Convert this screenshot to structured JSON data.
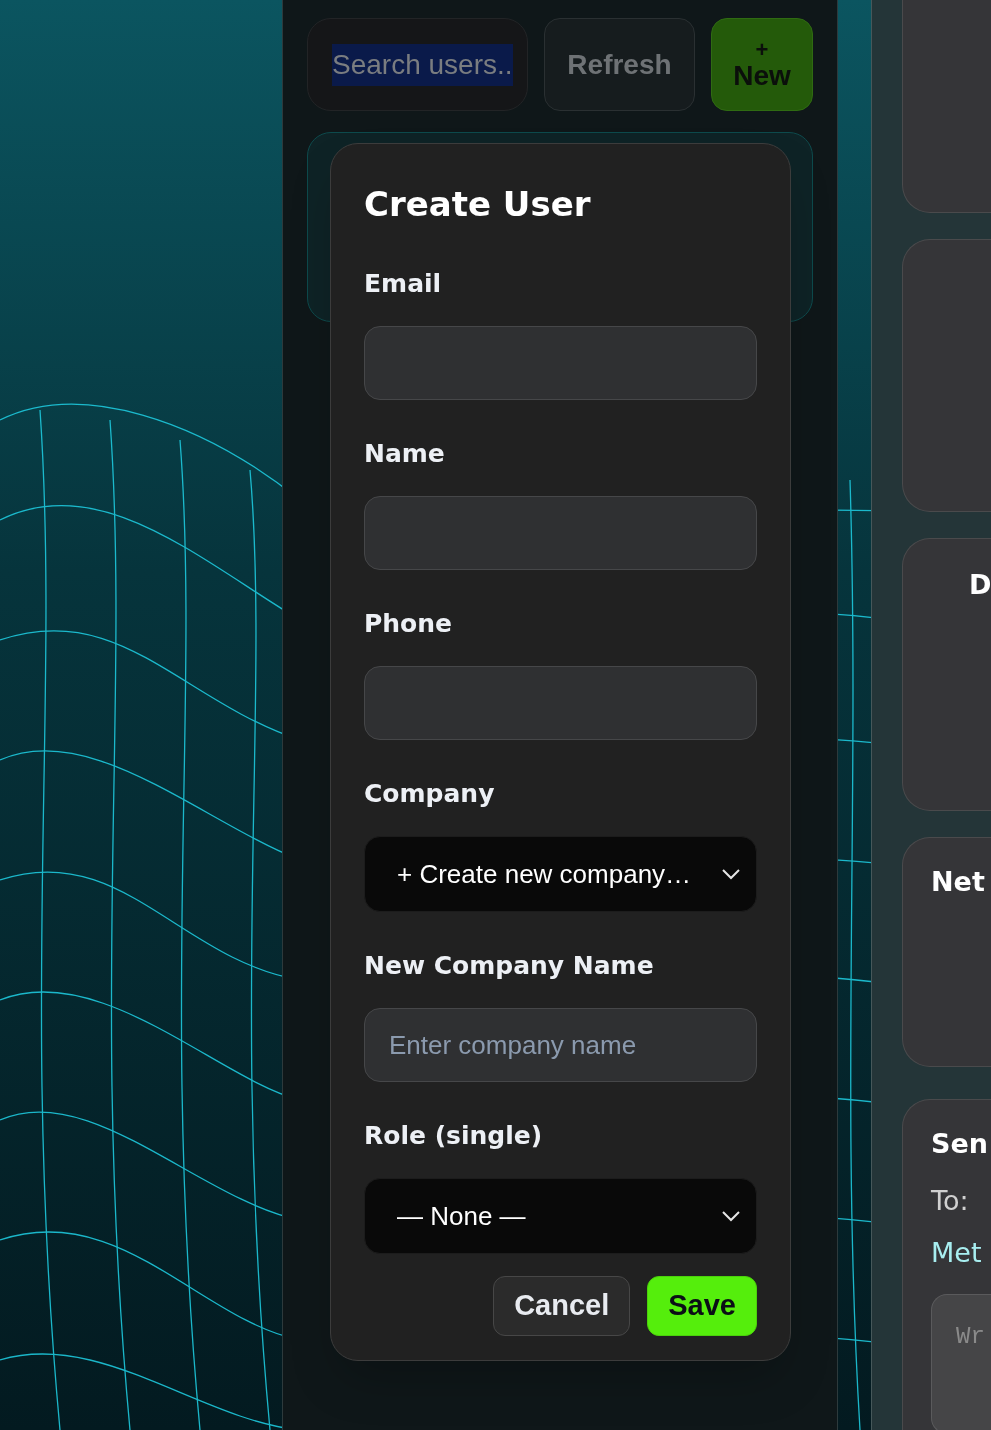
{
  "toolbar": {
    "search": {
      "value": "Search users..",
      "highlighted": true
    },
    "buttons": [
      {
        "label": "Refresh",
        "kind": "secondary"
      },
      {
        "label": "New",
        "icon": "+",
        "kind": "primary"
      }
    ]
  },
  "dialog": {
    "title": "Create User",
    "fields": [
      {
        "label": "Email",
        "kind": "input"
      },
      {
        "label": "Name",
        "kind": "input"
      },
      {
        "label": "Phone",
        "kind": "input"
      },
      {
        "label": "Company",
        "kind": "select",
        "value": "+ Create new company…"
      },
      {
        "label": "New Company Name",
        "kind": "input",
        "placeholder": "Enter company name"
      },
      {
        "label": "Role (single)",
        "kind": "select",
        "value": "— None —"
      }
    ],
    "buttons": [
      {
        "label": "Cancel",
        "kind": "secondary"
      },
      {
        "label": "Save",
        "kind": "primary"
      }
    ]
  },
  "side_cards": [
    {
      "kind": "blank"
    },
    {
      "kind": "blank"
    },
    {
      "kind": "titled",
      "title": "D"
    },
    {
      "kind": "titled",
      "title": "Net"
    },
    {
      "kind": "message",
      "title": "Sen",
      "to": "To:",
      "link": "Met",
      "placeholder": "Wr"
    }
  ]
}
